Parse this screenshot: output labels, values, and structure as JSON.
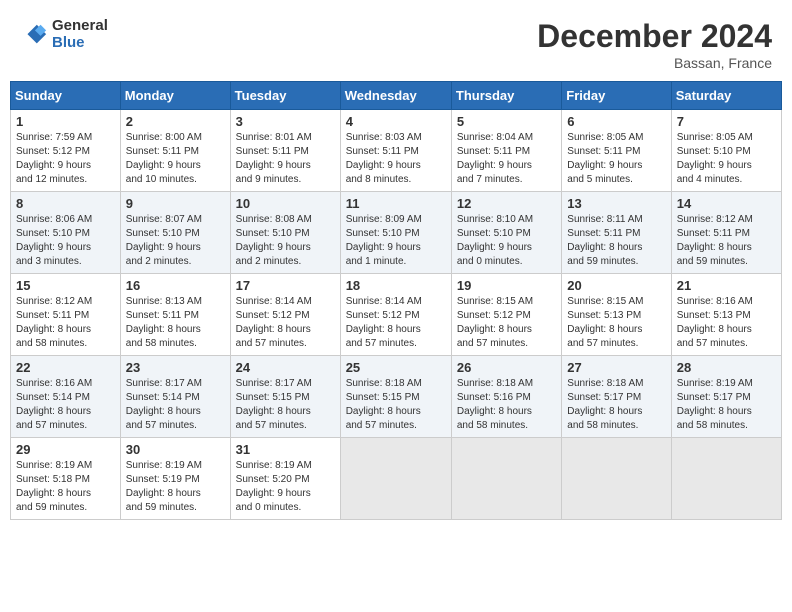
{
  "header": {
    "logo_line1": "General",
    "logo_line2": "Blue",
    "month": "December 2024",
    "location": "Bassan, France"
  },
  "weekdays": [
    "Sunday",
    "Monday",
    "Tuesday",
    "Wednesday",
    "Thursday",
    "Friday",
    "Saturday"
  ],
  "weeks": [
    [
      {
        "day": "1",
        "info": "Sunrise: 7:59 AM\nSunset: 5:12 PM\nDaylight: 9 hours\nand 12 minutes."
      },
      {
        "day": "2",
        "info": "Sunrise: 8:00 AM\nSunset: 5:11 PM\nDaylight: 9 hours\nand 10 minutes."
      },
      {
        "day": "3",
        "info": "Sunrise: 8:01 AM\nSunset: 5:11 PM\nDaylight: 9 hours\nand 9 minutes."
      },
      {
        "day": "4",
        "info": "Sunrise: 8:03 AM\nSunset: 5:11 PM\nDaylight: 9 hours\nand 8 minutes."
      },
      {
        "day": "5",
        "info": "Sunrise: 8:04 AM\nSunset: 5:11 PM\nDaylight: 9 hours\nand 7 minutes."
      },
      {
        "day": "6",
        "info": "Sunrise: 8:05 AM\nSunset: 5:11 PM\nDaylight: 9 hours\nand 5 minutes."
      },
      {
        "day": "7",
        "info": "Sunrise: 8:05 AM\nSunset: 5:10 PM\nDaylight: 9 hours\nand 4 minutes."
      }
    ],
    [
      {
        "day": "8",
        "info": "Sunrise: 8:06 AM\nSunset: 5:10 PM\nDaylight: 9 hours\nand 3 minutes."
      },
      {
        "day": "9",
        "info": "Sunrise: 8:07 AM\nSunset: 5:10 PM\nDaylight: 9 hours\nand 2 minutes."
      },
      {
        "day": "10",
        "info": "Sunrise: 8:08 AM\nSunset: 5:10 PM\nDaylight: 9 hours\nand 2 minutes."
      },
      {
        "day": "11",
        "info": "Sunrise: 8:09 AM\nSunset: 5:10 PM\nDaylight: 9 hours\nand 1 minute."
      },
      {
        "day": "12",
        "info": "Sunrise: 8:10 AM\nSunset: 5:10 PM\nDaylight: 9 hours\nand 0 minutes."
      },
      {
        "day": "13",
        "info": "Sunrise: 8:11 AM\nSunset: 5:11 PM\nDaylight: 8 hours\nand 59 minutes."
      },
      {
        "day": "14",
        "info": "Sunrise: 8:12 AM\nSunset: 5:11 PM\nDaylight: 8 hours\nand 59 minutes."
      }
    ],
    [
      {
        "day": "15",
        "info": "Sunrise: 8:12 AM\nSunset: 5:11 PM\nDaylight: 8 hours\nand 58 minutes."
      },
      {
        "day": "16",
        "info": "Sunrise: 8:13 AM\nSunset: 5:11 PM\nDaylight: 8 hours\nand 58 minutes."
      },
      {
        "day": "17",
        "info": "Sunrise: 8:14 AM\nSunset: 5:12 PM\nDaylight: 8 hours\nand 57 minutes."
      },
      {
        "day": "18",
        "info": "Sunrise: 8:14 AM\nSunset: 5:12 PM\nDaylight: 8 hours\nand 57 minutes."
      },
      {
        "day": "19",
        "info": "Sunrise: 8:15 AM\nSunset: 5:12 PM\nDaylight: 8 hours\nand 57 minutes."
      },
      {
        "day": "20",
        "info": "Sunrise: 8:15 AM\nSunset: 5:13 PM\nDaylight: 8 hours\nand 57 minutes."
      },
      {
        "day": "21",
        "info": "Sunrise: 8:16 AM\nSunset: 5:13 PM\nDaylight: 8 hours\nand 57 minutes."
      }
    ],
    [
      {
        "day": "22",
        "info": "Sunrise: 8:16 AM\nSunset: 5:14 PM\nDaylight: 8 hours\nand 57 minutes."
      },
      {
        "day": "23",
        "info": "Sunrise: 8:17 AM\nSunset: 5:14 PM\nDaylight: 8 hours\nand 57 minutes."
      },
      {
        "day": "24",
        "info": "Sunrise: 8:17 AM\nSunset: 5:15 PM\nDaylight: 8 hours\nand 57 minutes."
      },
      {
        "day": "25",
        "info": "Sunrise: 8:18 AM\nSunset: 5:15 PM\nDaylight: 8 hours\nand 57 minutes."
      },
      {
        "day": "26",
        "info": "Sunrise: 8:18 AM\nSunset: 5:16 PM\nDaylight: 8 hours\nand 58 minutes."
      },
      {
        "day": "27",
        "info": "Sunrise: 8:18 AM\nSunset: 5:17 PM\nDaylight: 8 hours\nand 58 minutes."
      },
      {
        "day": "28",
        "info": "Sunrise: 8:19 AM\nSunset: 5:17 PM\nDaylight: 8 hours\nand 58 minutes."
      }
    ],
    [
      {
        "day": "29",
        "info": "Sunrise: 8:19 AM\nSunset: 5:18 PM\nDaylight: 8 hours\nand 59 minutes."
      },
      {
        "day": "30",
        "info": "Sunrise: 8:19 AM\nSunset: 5:19 PM\nDaylight: 8 hours\nand 59 minutes."
      },
      {
        "day": "31",
        "info": "Sunrise: 8:19 AM\nSunset: 5:20 PM\nDaylight: 9 hours\nand 0 minutes."
      },
      {
        "day": "",
        "info": ""
      },
      {
        "day": "",
        "info": ""
      },
      {
        "day": "",
        "info": ""
      },
      {
        "day": "",
        "info": ""
      }
    ]
  ]
}
